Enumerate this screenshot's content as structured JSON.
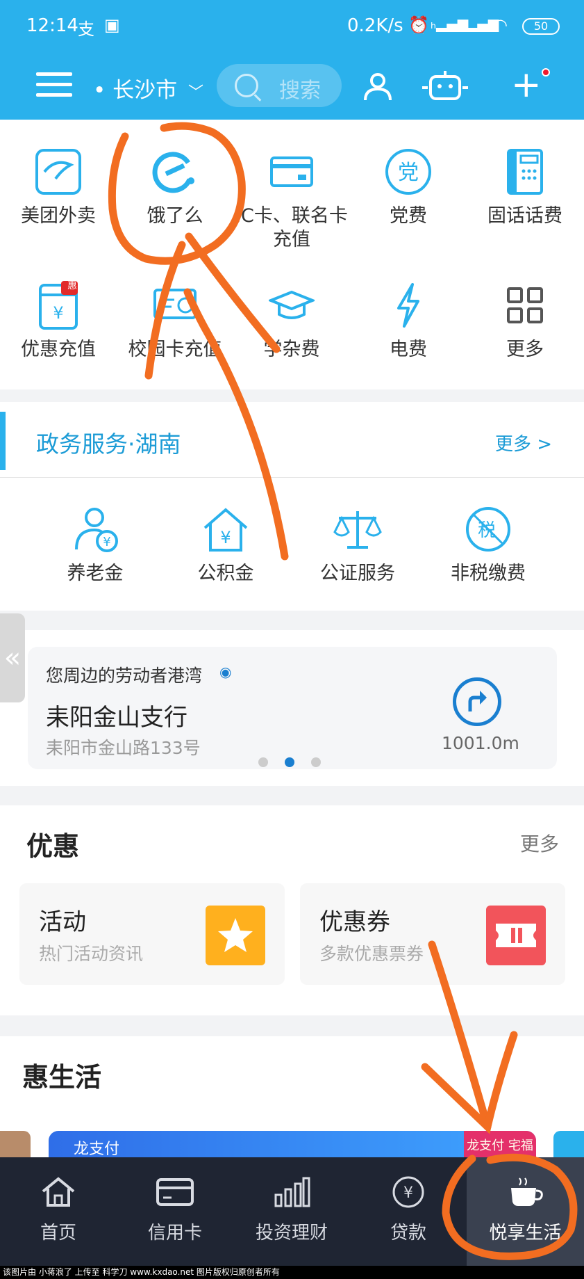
{
  "status_bar": {
    "time": "12:14",
    "net_speed": "0.2K/s",
    "battery": "50"
  },
  "header": {
    "city": "• 长沙市",
    "search_placeholder": "搜索"
  },
  "services": [
    {
      "label": "美团外卖",
      "icon": "meituan-icon"
    },
    {
      "label": "饿了么",
      "icon": "eleme-icon"
    },
    {
      "label": "IC卡、联名卡\n充值",
      "icon": "card-icon"
    },
    {
      "label": "党费",
      "icon": "party-icon"
    },
    {
      "label": "固话话费",
      "icon": "phone-icon"
    },
    {
      "label": "优惠充值",
      "icon": "recharge-icon",
      "badge": "惠"
    },
    {
      "label": "校园卡充值",
      "icon": "campus-card-icon"
    },
    {
      "label": "学杂费",
      "icon": "graduation-cap-icon"
    },
    {
      "label": "电费",
      "icon": "lightning-icon"
    },
    {
      "label": "更多",
      "icon": "grid-more-icon"
    }
  ],
  "gov": {
    "title": "政务服务·湖南",
    "more": "更多 >",
    "items": [
      {
        "label": "养老金",
        "icon": "pension-icon"
      },
      {
        "label": "公积金",
        "icon": "housing-fund-icon"
      },
      {
        "label": "公证服务",
        "icon": "scales-icon"
      },
      {
        "label": "非税缴费",
        "icon": "tax-icon",
        "glyph": "税"
      }
    ]
  },
  "outlet": {
    "heading": "您周边的劳动者港湾",
    "name": "耒阳金山支行",
    "address": "耒阳市金山路133号",
    "distance": "1001.0m",
    "side_tab": "«"
  },
  "promo": {
    "title": "优惠",
    "more": "更多",
    "cards": [
      {
        "title": "活动",
        "subtitle": "热门活动资讯",
        "color": "#ffb01e"
      },
      {
        "title": "优惠券",
        "subtitle": "多款优惠票券",
        "color": "#f2545b"
      }
    ]
  },
  "life": {
    "title": "惠生活",
    "banner_logo": "龙支付",
    "banner_tag": "龙支付 宅福利"
  },
  "tabs": [
    {
      "label": "首页",
      "icon": "home-icon"
    },
    {
      "label": "信用卡",
      "icon": "credit-card-icon"
    },
    {
      "label": "投资理财",
      "icon": "bar-chart-icon"
    },
    {
      "label": "贷款",
      "icon": "yuan-coin-icon"
    },
    {
      "label": "悦享生活",
      "icon": "coffee-cup-icon",
      "active": true
    }
  ],
  "footer": "该图片由 小蒋浪了 上传至 科学刀 www.kxdao.net 图片版权归原创者所有",
  "colors": {
    "header": "#2ab1ec",
    "annotation": "#f26d21",
    "tabbar": "#1f2533"
  }
}
